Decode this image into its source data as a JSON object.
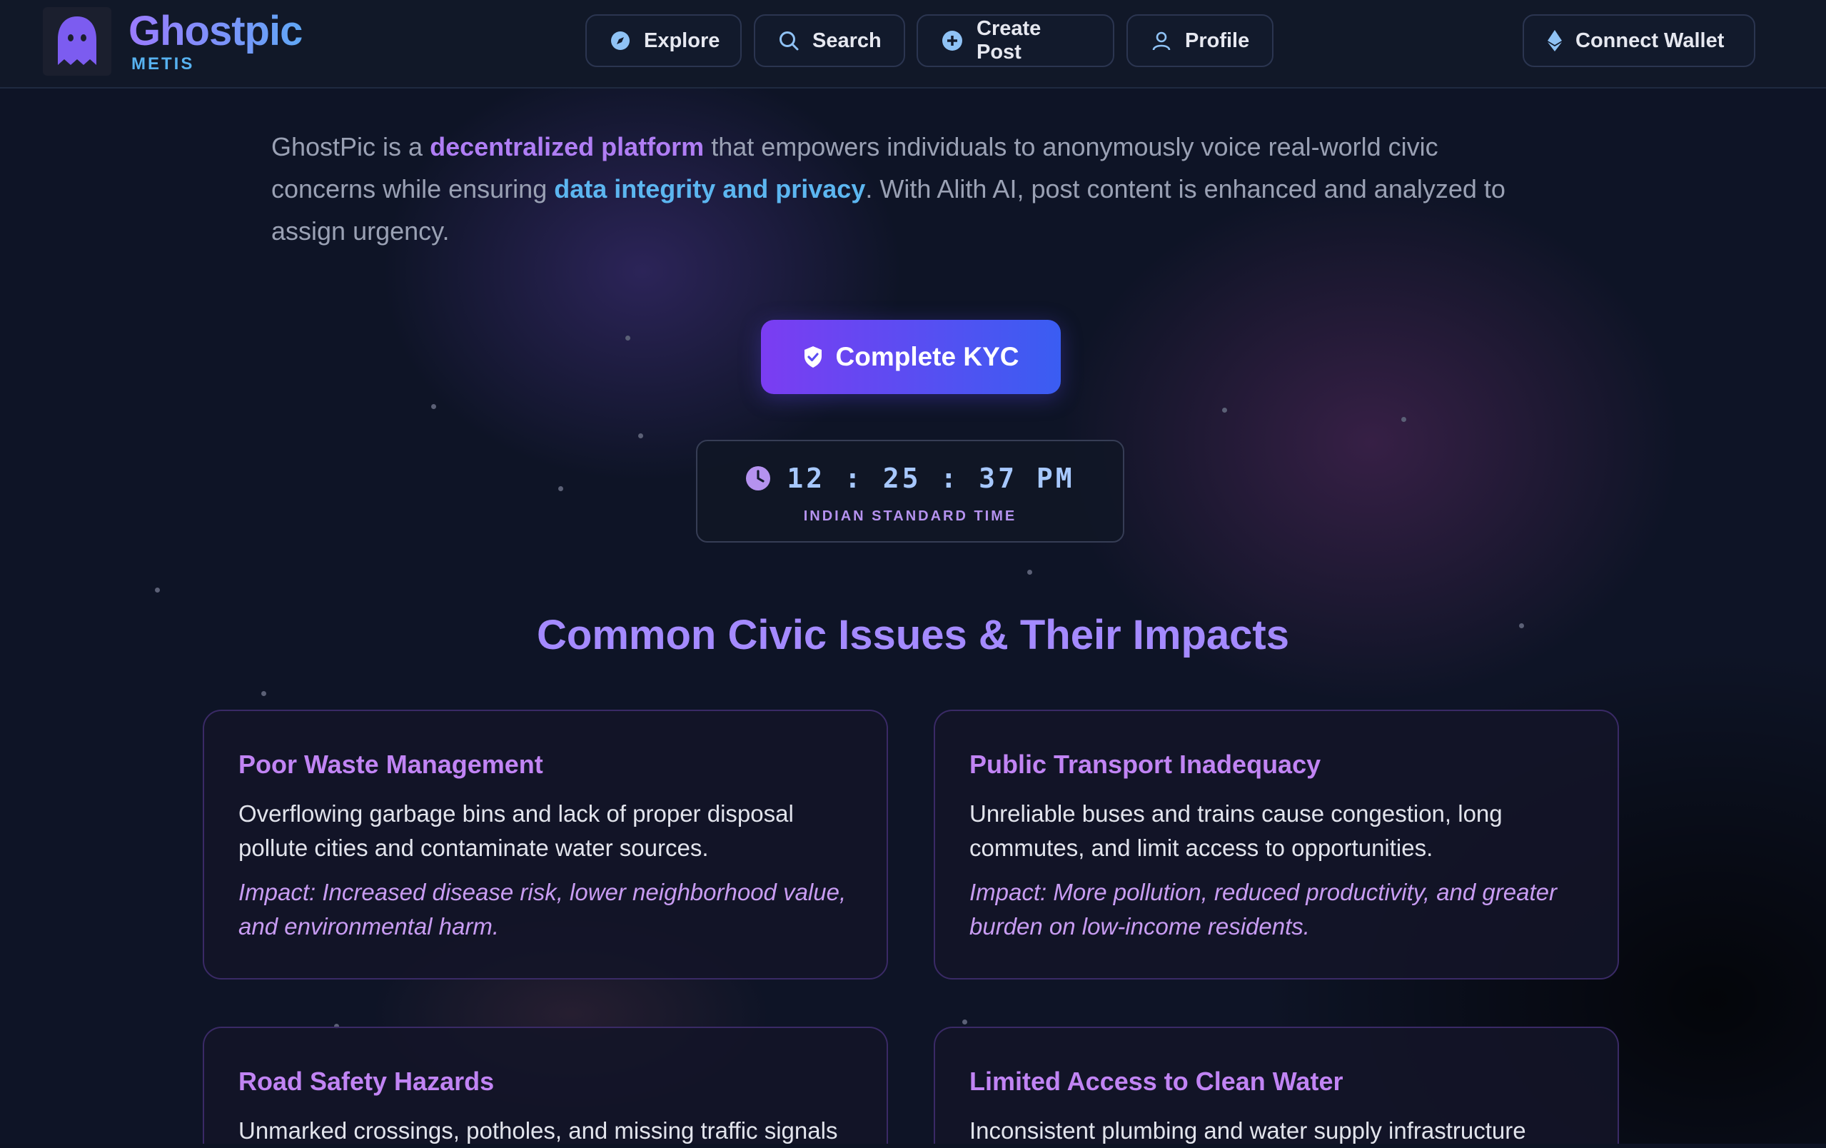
{
  "header": {
    "brand_title": "Ghostpic",
    "brand_sub": "METIS",
    "nav": [
      {
        "label": "Explore",
        "icon": "compass-icon"
      },
      {
        "label": "Search",
        "icon": "search-icon"
      },
      {
        "label": "Create Post",
        "icon": "plus-circle-icon"
      },
      {
        "label": "Profile",
        "icon": "user-icon"
      }
    ],
    "wallet_label": "Connect Wallet",
    "wallet_icon": "ethereum-icon"
  },
  "intro": {
    "t1": "GhostPic is a ",
    "h1": "decentralized platform",
    "t2": " that empowers individuals to anonymously voice real-world civic concerns while ensuring ",
    "h2": "data integrity and privacy",
    "t3": ". With Alith AI, post content is enhanced and analyzed to assign urgency."
  },
  "kyc": {
    "label": "Complete KYC",
    "icon": "shield-check-icon"
  },
  "clock": {
    "time": "12 : 25 : 37 PM",
    "zone": "INDIAN STANDARD TIME",
    "icon": "clock-icon"
  },
  "section": {
    "title": "Common Civic Issues & Their Impacts",
    "cards": [
      {
        "title": "Poor Waste Management",
        "desc": "Overflowing garbage bins and lack of proper disposal pollute cities and contaminate water sources.",
        "impact": "Impact: Increased disease risk, lower neighborhood value, and environmental harm."
      },
      {
        "title": "Public Transport Inadequacy",
        "desc": "Unreliable buses and trains cause congestion, long commutes, and limit access to opportunities.",
        "impact": "Impact: More pollution, reduced productivity, and greater burden on low-income residents."
      },
      {
        "title": "Road Safety Hazards",
        "desc": "Unmarked crossings, potholes, and missing traffic signals"
      },
      {
        "title": "Limited Access to Clean Water",
        "desc": "Inconsistent plumbing and water supply infrastructure"
      }
    ]
  },
  "colors": {
    "background": "#0e1426",
    "accent_purple": "#a48aff",
    "accent_blue": "#5cb6f0",
    "card_title": "#c184f4"
  }
}
